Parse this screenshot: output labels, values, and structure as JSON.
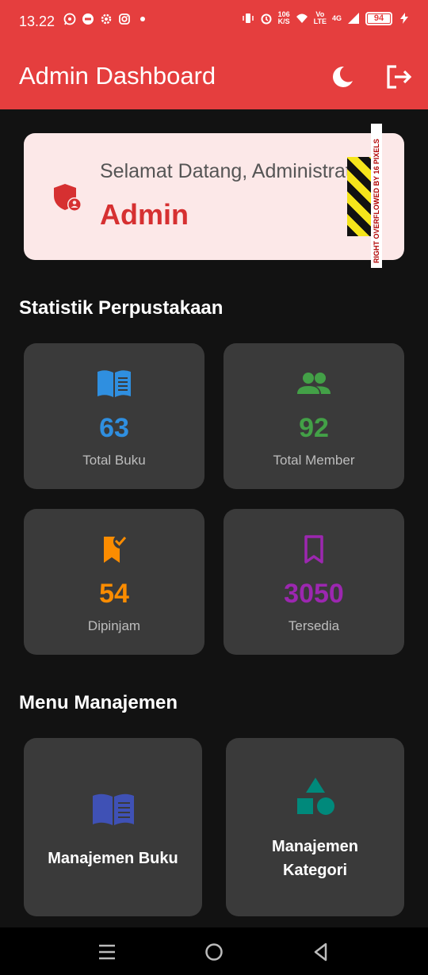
{
  "status_bar": {
    "time": "13.22",
    "net_speed_top": "106",
    "net_speed_bottom": "K/S",
    "volte_top": "Vo",
    "volte_bottom": "LTE",
    "network": "4G",
    "battery": "94"
  },
  "app_bar": {
    "title": "Admin Dashboard",
    "theme_icon": "moon-icon",
    "logout_icon": "logout-icon",
    "color": "#e53e3e"
  },
  "welcome": {
    "greeting": "Selamat Datang, Administrator",
    "name": "Admin",
    "icon": "admin-shield-icon",
    "overflow_warning": "RIGHT OVERFLOWED BY 16 PIXELS"
  },
  "stats": {
    "title": "Statistik Perpustakaan",
    "items": [
      {
        "value": "63",
        "label": "Total Buku",
        "icon": "book-open-icon",
        "color": "#2f8fe0"
      },
      {
        "value": "92",
        "label": "Total Member",
        "icon": "group-icon",
        "color": "#43a047"
      },
      {
        "value": "54",
        "label": "Dipinjam",
        "icon": "bookmark-added-icon",
        "color": "#fb8c00"
      },
      {
        "value": "3050",
        "label": "Tersedia",
        "icon": "bookmark-outline-icon",
        "color": "#9c27b0"
      }
    ]
  },
  "menu": {
    "title": "Menu Manajemen",
    "items": [
      {
        "label": "Manajemen Buku",
        "icon": "book-open-icon",
        "color": "#3f51b5"
      },
      {
        "label_line1": "Manajemen",
        "label_line2": "Kategori",
        "icon": "category-shapes-icon",
        "color": "#00897b"
      }
    ]
  },
  "nav_bar": {
    "recent_icon": "menu-lines-icon",
    "home_icon": "home-circle-icon",
    "back_icon": "back-triangle-icon"
  }
}
